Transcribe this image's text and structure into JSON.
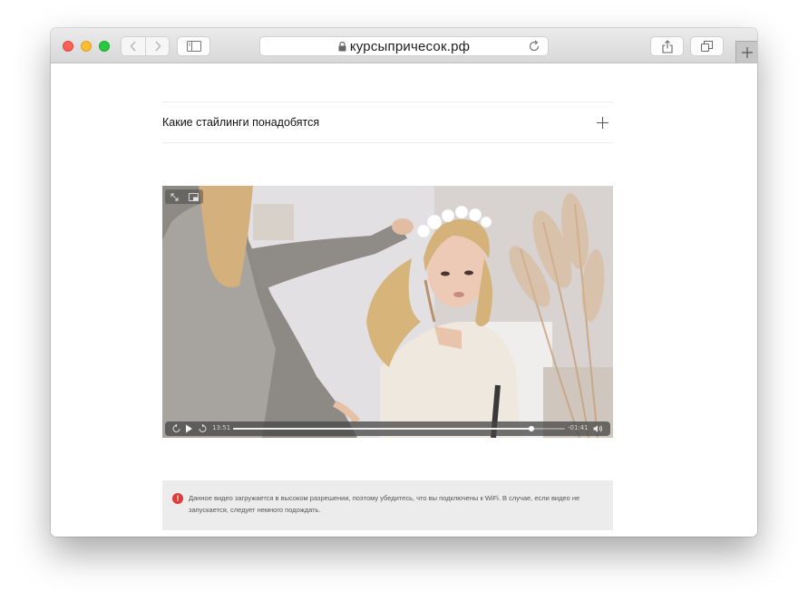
{
  "browser": {
    "url": "курсыпричесок.рф",
    "icons": {
      "close": "close-traffic-light",
      "minimize": "minimize-traffic-light",
      "zoom": "zoom-traffic-light",
      "back": "chevron-left-icon",
      "forward": "chevron-right-icon",
      "sidebar": "sidebar-icon",
      "lock": "lock-icon",
      "reload": "reload-icon",
      "share": "share-icon",
      "tabs": "tabs-overview-icon",
      "new_tab": "plus-icon"
    }
  },
  "page": {
    "accordion": {
      "title": "Какие стайлинги понадобятся",
      "expand_icon": "plus-icon"
    },
    "video": {
      "current_time": "13:51",
      "remaining_time": "-01:41",
      "progress": 0.9,
      "controls": [
        "rewind-15-icon",
        "play-icon",
        "forward-15-icon",
        "volume-icon"
      ],
      "top_controls": [
        "fullscreen-icon",
        "picture-in-picture-icon"
      ]
    },
    "notice": {
      "icon": "info-icon",
      "icon_glyph": "!",
      "text": "Данное видео загружается в высоком разрешении, поэтому убедитесь, что вы подключены к WiFi. В случае, если видео не запускается, следует немного подождать."
    }
  }
}
